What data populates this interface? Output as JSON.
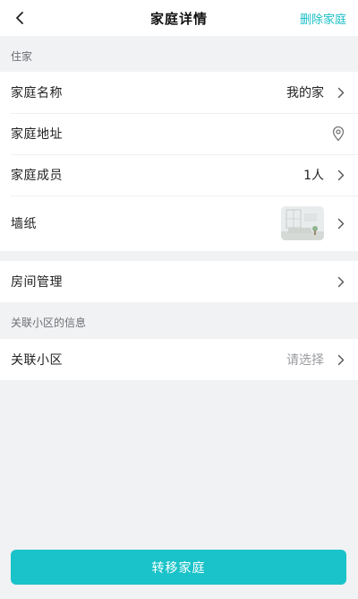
{
  "header": {
    "title": "家庭详情",
    "delete_label": "删除家庭"
  },
  "sections": {
    "home_label": "住家",
    "community_info_label": "关联小区的信息"
  },
  "home_rows": {
    "name": {
      "label": "家庭名称",
      "value": "我的家"
    },
    "address": {
      "label": "家庭地址"
    },
    "members": {
      "label": "家庭成员",
      "value": "1人"
    },
    "wallpaper": {
      "label": "墙纸"
    }
  },
  "room_management": {
    "label": "房间管理"
  },
  "community": {
    "label": "关联小区",
    "value": "请选择"
  },
  "footer": {
    "transfer_label": "转移家庭"
  },
  "colors": {
    "accent": "#19c3c9",
    "background": "#f1f2f4"
  }
}
